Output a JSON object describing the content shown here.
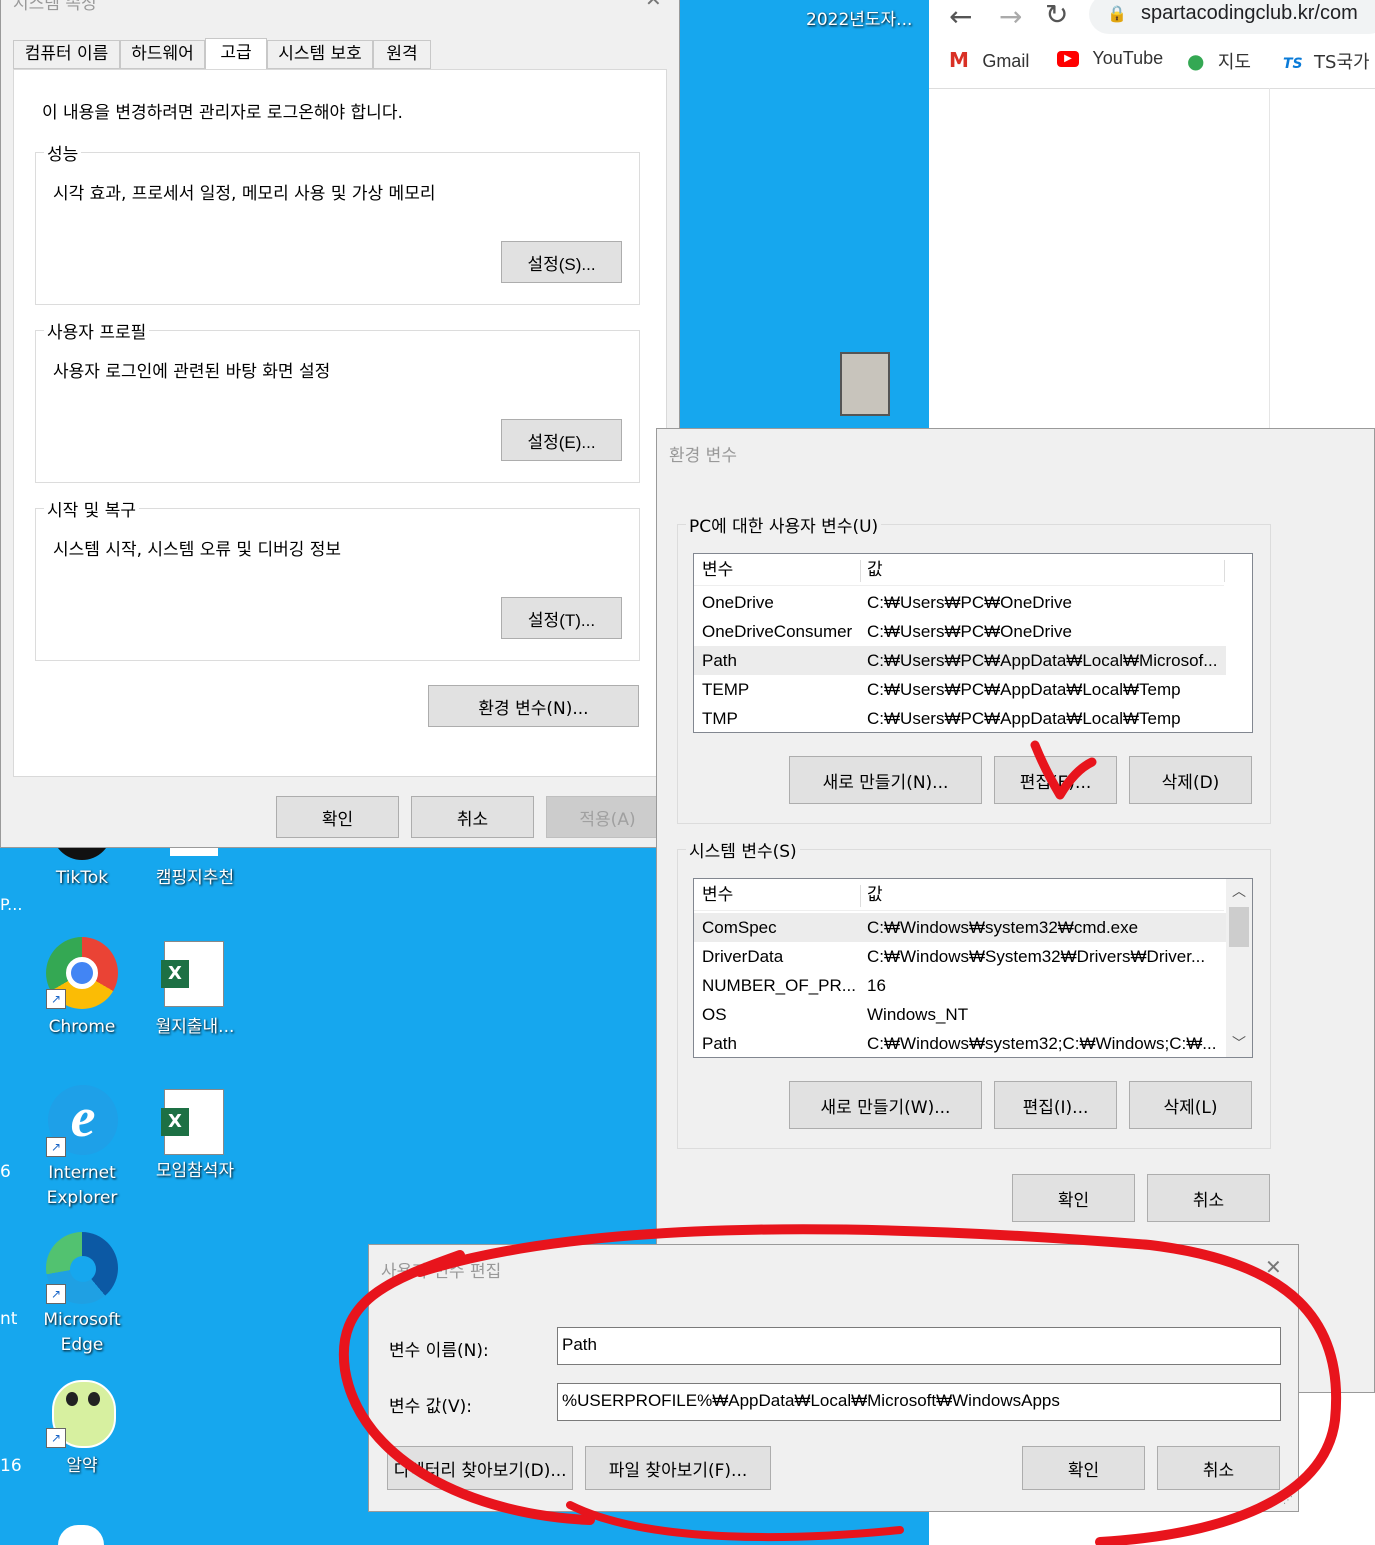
{
  "desktop": {
    "top_labels": [
      "2022년도자..."
    ],
    "icons": [
      {
        "label": "TikTok"
      },
      {
        "label": "캠핑지추천"
      },
      {
        "label": "Chrome"
      },
      {
        "label": "월지출내..."
      },
      {
        "label": "Internet Explorer"
      },
      {
        "label": "모임참석자"
      },
      {
        "label": "Microsoft Edge"
      },
      {
        "label": "알약"
      }
    ],
    "edge_fragments": [
      "P...",
      "6",
      "nt",
      "16"
    ]
  },
  "browser": {
    "url": "spartacodingclub.kr/com",
    "bookmarks": [
      "Gmail",
      "YouTube",
      "지도",
      "TS국가"
    ]
  },
  "system_properties": {
    "title": "시스템 속성",
    "tabs": [
      "컴퓨터 이름",
      "하드웨어",
      "고급",
      "시스템 보호",
      "원격"
    ],
    "active_tab": "고급",
    "admin_notice": "이 내용을 변경하려면 관리자로 로그온해야 합니다.",
    "performance": {
      "title": "성능",
      "desc": "시각 효과, 프로세서 일정, 메모리 사용 및 가상 메모리",
      "button": "설정(S)..."
    },
    "user_profile": {
      "title": "사용자 프로필",
      "desc": "사용자 로그인에 관련된 바탕 화면 설정",
      "button": "설정(E)..."
    },
    "startup": {
      "title": "시작 및 복구",
      "desc": "시스템 시작, 시스템 오류 및 디버깅 정보",
      "button": "설정(T)..."
    },
    "env_button": "환경 변수(N)...",
    "ok": "확인",
    "cancel": "취소",
    "apply": "적용(A)"
  },
  "env_vars": {
    "title": "환경 변수",
    "user_group": "PC에 대한 사용자 변수(U)",
    "col_var": "변수",
    "col_val": "값",
    "user_rows": [
      {
        "name": "OneDrive",
        "value": "C:₩Users₩PC₩OneDrive"
      },
      {
        "name": "OneDriveConsumer",
        "value": "C:₩Users₩PC₩OneDrive"
      },
      {
        "name": "Path",
        "value": "C:₩Users₩PC₩AppData₩Local₩Microsof..."
      },
      {
        "name": "TEMP",
        "value": "C:₩Users₩PC₩AppData₩Local₩Temp"
      },
      {
        "name": "TMP",
        "value": "C:₩Users₩PC₩AppData₩Local₩Temp"
      }
    ],
    "user_buttons": {
      "new": "새로 만들기(N)...",
      "edit": "편집(E)...",
      "delete": "삭제(D)"
    },
    "system_group": "시스템 변수(S)",
    "system_rows": [
      {
        "name": "ComSpec",
        "value": "C:₩Windows₩system32₩cmd.exe"
      },
      {
        "name": "DriverData",
        "value": "C:₩Windows₩System32₩Drivers₩Driver..."
      },
      {
        "name": "NUMBER_OF_PR...",
        "value": "16"
      },
      {
        "name": "OS",
        "value": "Windows_NT"
      },
      {
        "name": "Path",
        "value": "C:₩Windows₩system32;C:₩Windows;C:₩..."
      }
    ],
    "system_buttons": {
      "new": "새로 만들기(W)...",
      "edit": "편집(I)...",
      "delete": "삭제(L)"
    },
    "ok": "확인",
    "cancel": "취소"
  },
  "edit_dialog": {
    "title": "사용자 변수 편집",
    "name_label": "변수 이름(N):",
    "name_value": "Path",
    "value_label": "변수 값(V):",
    "value_value": "%USERPROFILE%₩AppData₩Local₩Microsoft₩WindowsApps",
    "browse_dir": "디렉터리 찾아보기(D)...",
    "browse_file": "파일 찾아보기(F)...",
    "ok": "확인",
    "cancel": "취소"
  },
  "colors": {
    "desktop": "#16a7ee",
    "annotation": "#e8141c"
  }
}
